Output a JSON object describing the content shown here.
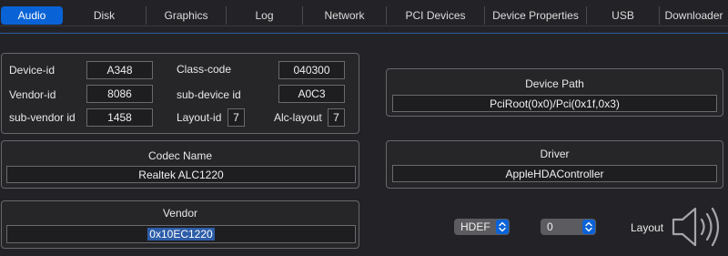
{
  "tabs": [
    {
      "label": "Audio",
      "active": true
    },
    {
      "label": "Disk"
    },
    {
      "label": "Graphics"
    },
    {
      "label": "Log"
    },
    {
      "label": "Network"
    },
    {
      "label": "PCI Devices"
    },
    {
      "label": "Device Properties"
    },
    {
      "label": "USB"
    },
    {
      "label": "Downloader"
    }
  ],
  "ids": {
    "device_id_label": "Device-id",
    "device_id": "A348",
    "vendor_id_label": "Vendor-id",
    "vendor_id": "8086",
    "sub_vendor_id_label": "sub-vendor id",
    "sub_vendor_id": "1458",
    "class_code_label": "Class-code",
    "class_code": "040300",
    "sub_device_id_label": "sub-device id",
    "sub_device_id": "A0C3",
    "layout_id_label": "Layout-id",
    "layout_id": "7",
    "alc_layout_label": "Alc-layout",
    "alc_layout": "7"
  },
  "device_path": {
    "title": "Device Path",
    "value": "PciRoot(0x0)/Pci(0x1f,0x3)"
  },
  "codec": {
    "title": "Codec Name",
    "value": "Realtek ALC1220"
  },
  "driver": {
    "title": "Driver",
    "value": "AppleHDAController"
  },
  "vendor": {
    "title": "Vendor",
    "value": "0x10EC1220"
  },
  "controls": {
    "hdef": "HDEF",
    "layout_value": "0",
    "layout_label": "Layout",
    "icon": "speaker-volume-icon"
  },
  "colors": {
    "accent": "#0a63d6",
    "background": "#232327"
  }
}
